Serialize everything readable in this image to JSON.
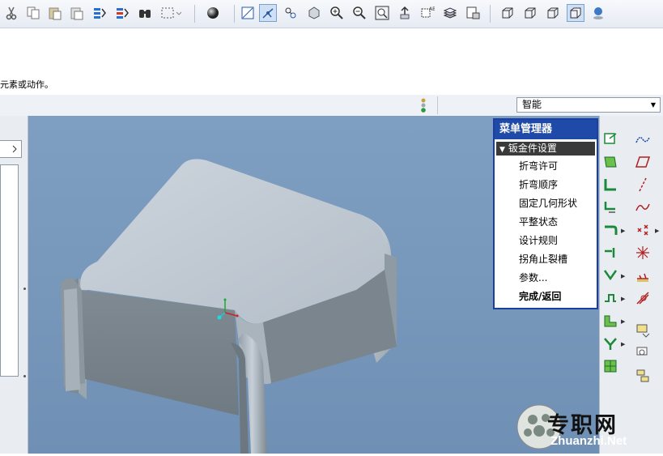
{
  "toolbar": {
    "icons": [
      "cut-icon",
      "copy-icon",
      "paste-icon",
      "paste-special-icon",
      "regenerate-icon",
      "regen-manager-icon",
      "find-icon",
      "select-box-icon",
      "shade-sphere-icon",
      "plane-display-icon",
      "axis-display-icon",
      "point-display-icon",
      "csys-display-icon",
      "zoom-in-icon",
      "zoom-out-icon",
      "refit-icon",
      "reorient-icon",
      "saved-views-icon",
      "layers-icon",
      "view-manager-icon",
      "wireframe-icon",
      "hidden-line-icon",
      "no-hidden-icon",
      "shaded-icon",
      "appearance-icon"
    ]
  },
  "message": {
    "text": "元素或动作。"
  },
  "status": {
    "filter_value": "智能"
  },
  "menu_manager": {
    "title": "菜单管理器",
    "header": "钣金件设置",
    "items": [
      "折弯许可",
      "折弯顺序",
      "固定几何形状",
      "平整状态",
      "设计规则",
      "拐角止裂槽",
      "参数...",
      "完成/返回"
    ]
  },
  "watermark": {
    "cn": "专职网",
    "en": "Zhuanzhi.Net"
  },
  "colors": {
    "viewport_bg": "#7b9cbf",
    "menu_title_bg": "#1f4aa8",
    "menu_header_bg": "#3a3a3a",
    "model_top": "#c3ccd5",
    "model_side": "#8d989f"
  }
}
